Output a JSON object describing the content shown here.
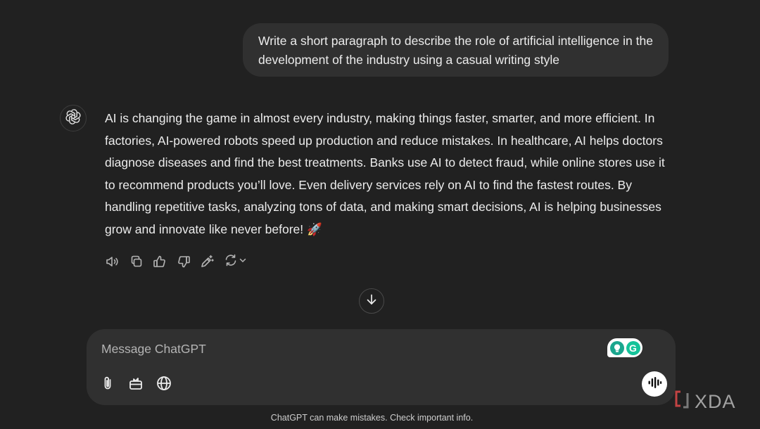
{
  "conversation": {
    "user_message": "Write a short paragraph to describe the role of artificial intelligence in the development of the industry using a casual writing style",
    "assistant_message": "AI is changing the game in almost every industry, making things faster, smarter, and more efficient. In factories, AI-powered robots speed up production and reduce mistakes. In healthcare, AI helps doctors diagnose diseases and find the best treatments. Banks use AI to detect fraud, while online stores use it to recommend products you’ll love. Even delivery services rely on AI to find the fastest routes. By handling repetitive tasks, analyzing tons of data, and making smart decisions, AI is helping businesses grow and innovate like never before! 🚀",
    "assistant_avatar_icon": "openai-logo-icon"
  },
  "message_actions": [
    {
      "name": "read-aloud",
      "icon": "speaker-icon"
    },
    {
      "name": "copy",
      "icon": "copy-icon"
    },
    {
      "name": "good-response",
      "icon": "thumbs-up-icon"
    },
    {
      "name": "bad-response",
      "icon": "thumbs-down-icon"
    },
    {
      "name": "edit-in-canvas",
      "icon": "pen-sparkle-icon"
    },
    {
      "name": "regenerate",
      "icon": "refresh-icon"
    }
  ],
  "scroll_down_icon": "arrow-down-icon",
  "composer": {
    "placeholder": "Message ChatGPT",
    "value": "",
    "tools": [
      {
        "name": "attach",
        "icon": "paperclip-icon"
      },
      {
        "name": "tools",
        "icon": "toolbox-icon"
      },
      {
        "name": "search",
        "icon": "globe-icon"
      }
    ],
    "voice_icon": "voice-waveform-icon",
    "extension_badge": "G"
  },
  "footer": {
    "disclaimer": "ChatGPT can make mistakes. Check important info."
  },
  "watermark": {
    "text": "XDA"
  },
  "colors": {
    "background": "#212121",
    "bubble": "#303030",
    "text": "#ececec",
    "grammarly_green": "#15c39a",
    "grammarly_teal": "#1aa68e"
  }
}
